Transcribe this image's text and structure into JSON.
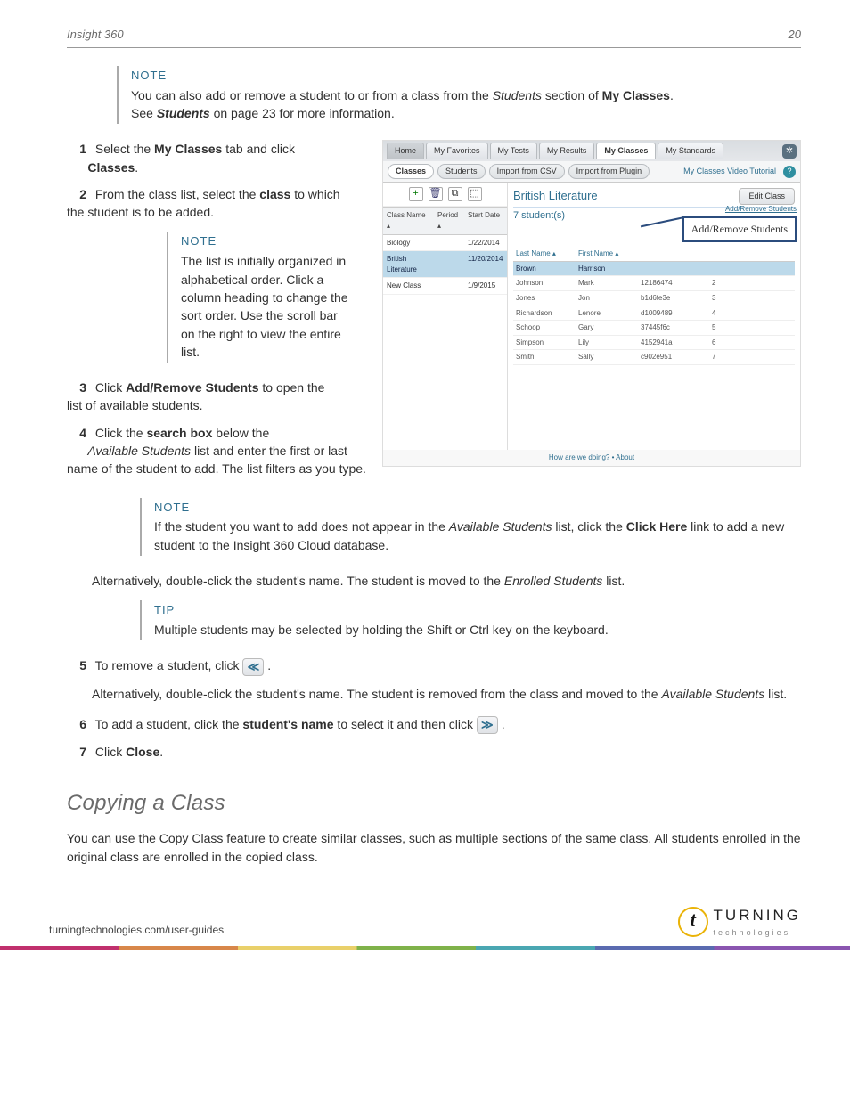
{
  "header": {
    "title": "Insight 360",
    "page_number": "20"
  },
  "note1": {
    "title": "NOTE",
    "text_before": "You can also add or remove a student to or from a class from the ",
    "text_em1": "Students",
    "text_mid": " section of ",
    "text_b1": "My Classes",
    "text_dot": ".",
    "line2_before": "See ",
    "line2_b": "Students",
    "line2_after": " on page 23 for more information."
  },
  "steps": {
    "s1_before": "Select the ",
    "s1_b1": "My Classes",
    "s1_mid": " tab and click ",
    "s1_b2": "Classes",
    "s1_dot": ".",
    "s2_before": "From the class list, select the ",
    "s2_b": "class",
    "s2_after": " to which the student is to be added.",
    "s3_before": "Click ",
    "s3_b": "Add/Remove Students",
    "s3_after": " to open the list of available students.",
    "s4_before": "Click the ",
    "s4_b": "search box",
    "s4_mid": " below the ",
    "s4_em": "Available Students",
    "s4_after": " list and enter the first or last name of the student to add. The list filters as you type.",
    "s5_before": "To remove a student, click ",
    "s5_dot": ".",
    "s5_alt_before": "Alternatively, double-click the student's name. The student is removed from the class and moved to the ",
    "s5_alt_em": "Available Students",
    "s5_alt_after": " list.",
    "s6_before": "To add a student, click the ",
    "s6_b": "student's name",
    "s6_mid": " to select it and then click ",
    "s6_dot": ".",
    "s7_before": "Click ",
    "s7_b": "Close",
    "s7_dot": "."
  },
  "note2": {
    "title": "NOTE",
    "body": "The list is initially organized in alphabetical order. Click a column heading to change the sort order. Use the scroll bar on the right to view the entire list."
  },
  "note3": {
    "title": "NOTE",
    "before": "If the student you want to add does not appear in the ",
    "em1": "Available Students",
    "mid": " list, click the ",
    "b1": "Click Here",
    "after": " link to add a new student to the Insight 360 Cloud database."
  },
  "alt_line": {
    "before": "Alternatively, double-click the student's name. The student is moved to the ",
    "em": "Enrolled Students",
    "after": " list."
  },
  "tip1": {
    "title": "TIP",
    "body": "Multiple students may be selected by holding the Shift or Ctrl key on the keyboard."
  },
  "section2": {
    "title": "Copying a Class",
    "body": "You can use the Copy Class feature to create similar classes, such as multiple sections of the same class. All students enrolled in the original class are enrolled in the copied class."
  },
  "footer": {
    "url": "turningtechnologies.com/user-guides",
    "logo_top": "TURNING",
    "logo_bottom": "technologies",
    "logo_letter": "t"
  },
  "screenshot": {
    "tabs": {
      "home": "Home",
      "fav": "My Favorites",
      "tests": "My Tests",
      "results": "My Results",
      "classes": "My Classes",
      "standards": "My Standards"
    },
    "toolbar": {
      "classes": "Classes",
      "students": "Students",
      "csv": "Import from CSV",
      "plugin": "Import from Plugin",
      "video": "My Classes Video Tutorial"
    },
    "left": {
      "columns": {
        "c1": "Class Name ▴",
        "c2": "Period ▴",
        "c3": "Start Date"
      },
      "rows": [
        {
          "name": "Biology",
          "period": "",
          "date": "1/22/2014"
        },
        {
          "name": "British Literature",
          "period": "",
          "date": "11/20/2014"
        },
        {
          "name": "New Class",
          "period": "",
          "date": "1/9/2015"
        }
      ],
      "icons": {
        "add": "+",
        "trash": "🗑",
        "copy": "⧉",
        "chart": "⬚"
      }
    },
    "right": {
      "name": "British Literature",
      "edit_btn": "Edit Class",
      "count": "7 student(s)",
      "addremove_link": "Add/Remove Students",
      "label": "Add/Remove Students",
      "columns": {
        "c1": "Last Name ▴",
        "c2": "First Name ▴",
        "c3": "",
        "c4": ""
      },
      "students": [
        {
          "ln": "Brown",
          "fn": "Harrison",
          "id": "",
          "n": ""
        },
        {
          "ln": "Johnson",
          "fn": "Mark",
          "id": "12186474",
          "n": "2"
        },
        {
          "ln": "Jones",
          "fn": "Jon",
          "id": "b1d6fe3e",
          "n": "3"
        },
        {
          "ln": "Richardson",
          "fn": "Lenore",
          "id": "d1009489",
          "n": "4"
        },
        {
          "ln": "Schoop",
          "fn": "Gary",
          "id": "37445f6c",
          "n": "5"
        },
        {
          "ln": "Simpson",
          "fn": "Lily",
          "id": "4152941a",
          "n": "6"
        },
        {
          "ln": "Smith",
          "fn": "Sally",
          "id": "c902e951",
          "n": "7"
        }
      ],
      "footer": "How are we doing?  •  About"
    }
  }
}
